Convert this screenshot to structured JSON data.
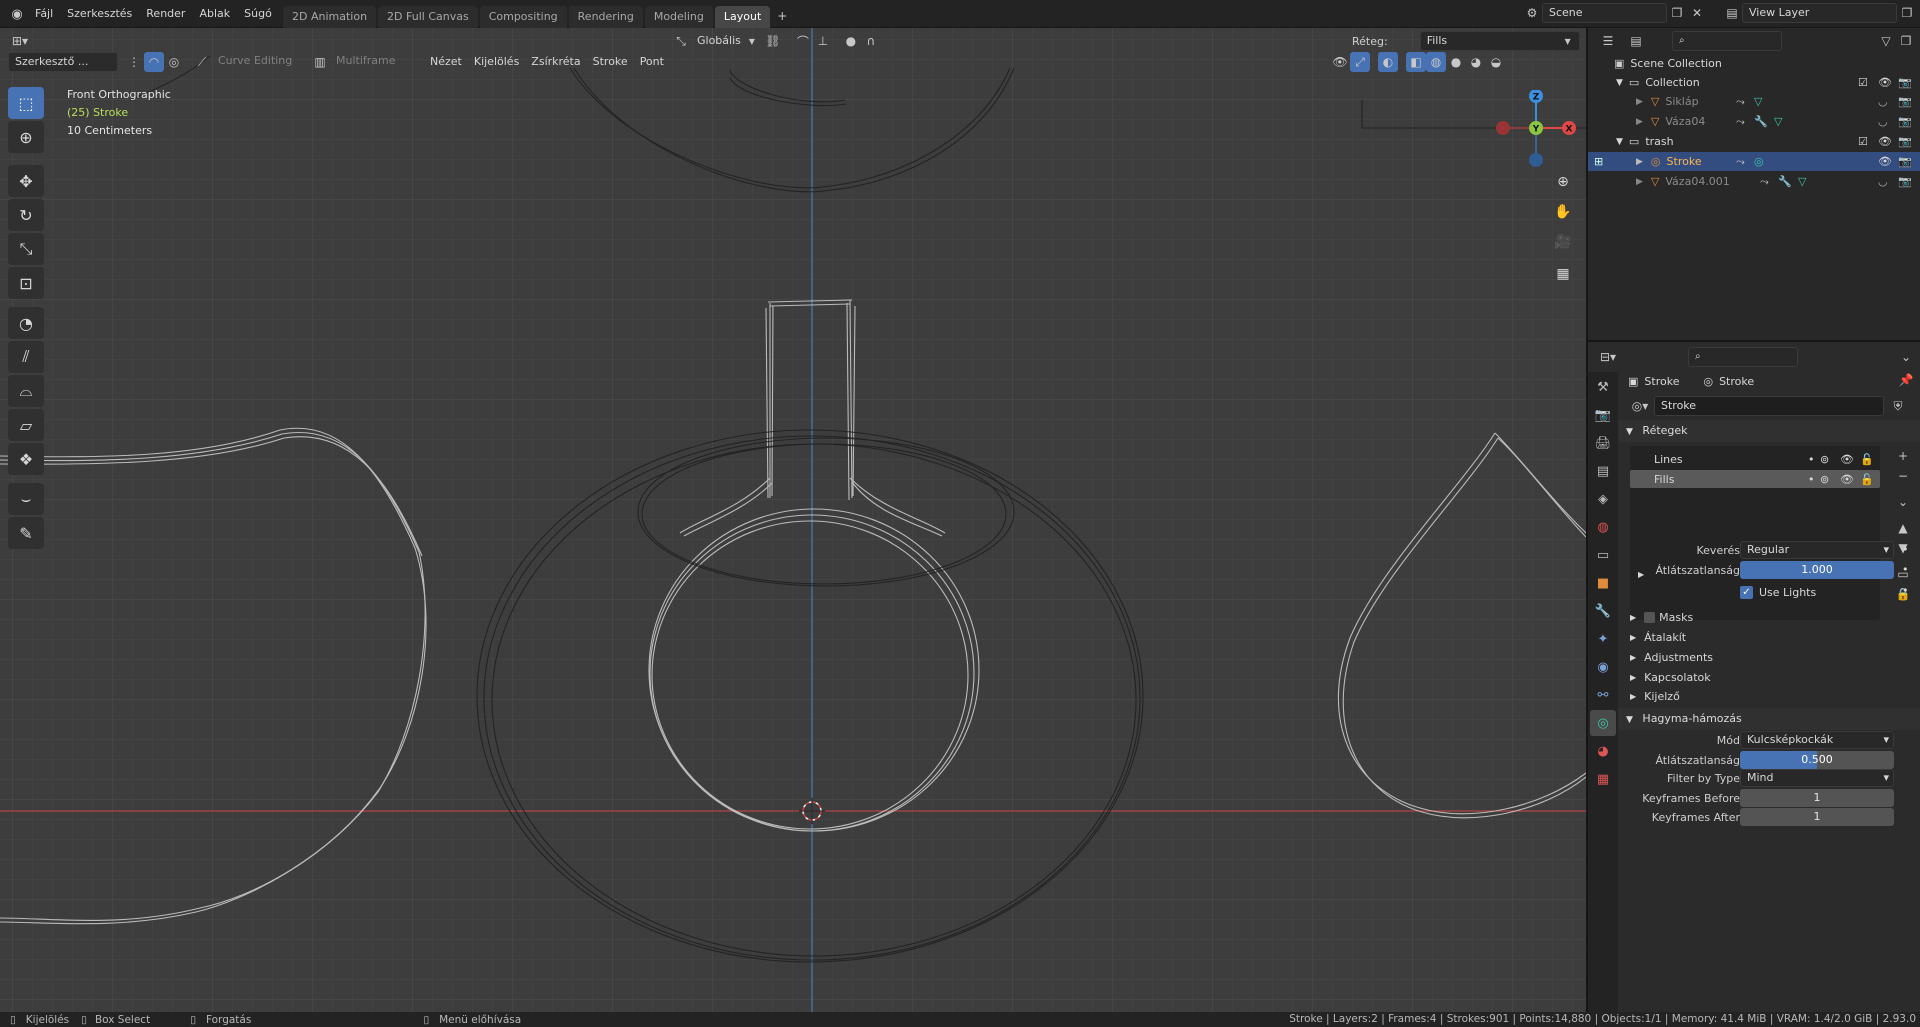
{
  "topbar": {
    "menus": [
      "Fájl",
      "Szerkesztés",
      "Render",
      "Ablak",
      "Súgó"
    ],
    "workspaces": [
      "2D Animation",
      "2D Full Canvas",
      "Compositing",
      "Rendering",
      "Modeling",
      "Layout"
    ],
    "active_workspace": "Layout",
    "scene": "Scene",
    "view_layer": "View Layer"
  },
  "viewport_header": {
    "editor_mode": "Szerkesztő ...",
    "curve_editing": "Curve Editing",
    "multiframe": "Multiframe",
    "menus": [
      "Nézet",
      "Kijelölés",
      "Zsírkréta",
      "Stroke",
      "Pont"
    ],
    "orientation": "Globális",
    "layer_label": "Réteg:",
    "layer_value": "Fills"
  },
  "viewport_info": {
    "view_name": "Front Orthographic",
    "object_line": "(25) Stroke",
    "scale_line": "10 Centimeters"
  },
  "gizmo": {
    "z": "Z",
    "y": "Y",
    "x": "X"
  },
  "tools": [
    "select-box",
    "cursor",
    "move",
    "rotate",
    "scale",
    "transform",
    "radius",
    "shear",
    "bend",
    "extrude",
    "to-sphere",
    "interpolate",
    "annotate"
  ],
  "outliner": {
    "search_placeholder": "",
    "items": [
      {
        "label": "Scene Collection",
        "depth": 0
      },
      {
        "label": "Collection",
        "depth": 1
      },
      {
        "label": "Sikláp",
        "depth": 2
      },
      {
        "label": "Váza04",
        "depth": 2
      },
      {
        "label": "trash",
        "depth": 1
      },
      {
        "label": "Stroke",
        "depth": 2,
        "selected": true
      },
      {
        "label": "Váza04.001",
        "depth": 2
      }
    ]
  },
  "properties": {
    "breadcrumb_obj": "Stroke",
    "breadcrumb_data": "Stroke",
    "datablock_name": "Stroke",
    "layers_panel_title": "Rétegek",
    "layers": [
      {
        "name": "Lines",
        "active": false
      },
      {
        "name": "Fills",
        "active": true
      }
    ],
    "blend_label": "Keverés",
    "blend_value": "Regular",
    "opacity_label": "Átlátszatlanság",
    "opacity_value": "1.000",
    "use_lights_label": "Use Lights",
    "subpanels": [
      "Masks",
      "Átalakít",
      "Adjustments",
      "Kapcsolatok",
      "Kijelző"
    ],
    "onion_panel_title": "Hagyma-hámozás",
    "mode_label": "Mód",
    "mode_value": "Kulcsképkockák",
    "onion_opacity_label": "Átlátszatlanság",
    "onion_opacity_value": "0.500",
    "filter_label": "Filter by Type",
    "filter_value": "Mind",
    "kf_before_label": "Keyframes Before",
    "kf_before_value": "1",
    "kf_after_label": "Keyframes After",
    "kf_after_value": "1"
  },
  "statusbar": {
    "select": "Kijelölés",
    "box_select": "Box Select",
    "rotate": "Forgatás",
    "menu": "Menü előhívása",
    "stats": "Stroke | Layers:2 | Frames:4 | Strokes:901 | Points:14,880 | Objects:1/1 | Memory: 41.4 MiB | VRAM: 1.4/2.0 GiB | 2.93.0"
  },
  "colors": {
    "accent": "#4772b3",
    "selected_row": "#334d80",
    "x_axis": "#c44b4b",
    "y_axis": "#4f86c6",
    "gizmo_x": "#e04848",
    "gizmo_y": "#8cc63f",
    "gizmo_z": "#3b8fe0"
  }
}
